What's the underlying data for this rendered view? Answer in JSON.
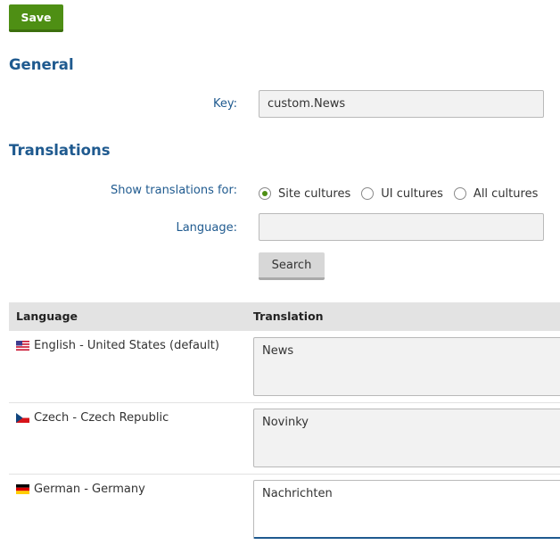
{
  "toolbar": {
    "save_label": "Save"
  },
  "general": {
    "title": "General",
    "key_label": "Key:",
    "key_value": "custom.News"
  },
  "translations": {
    "title": "Translations",
    "show_label": "Show translations for:",
    "options": [
      {
        "label": "Site cultures",
        "checked": true
      },
      {
        "label": "UI cultures",
        "checked": false
      },
      {
        "label": "All cultures",
        "checked": false
      }
    ],
    "language_label": "Language:",
    "language_value": "",
    "search_label": "Search"
  },
  "table": {
    "headers": {
      "language": "Language",
      "translation": "Translation"
    },
    "rows": [
      {
        "language": "English - United States (default)",
        "flag": "us-flag-icon",
        "translation": "News"
      },
      {
        "language": "Czech - Czech Republic",
        "flag": "cz-flag-icon",
        "translation": "Novinky"
      },
      {
        "language": "German - Germany",
        "flag": "de-flag-icon",
        "translation": "Nachrichten"
      }
    ]
  },
  "colors": {
    "accent_green": "#4e8f14",
    "heading_blue": "#1f5a8f"
  }
}
